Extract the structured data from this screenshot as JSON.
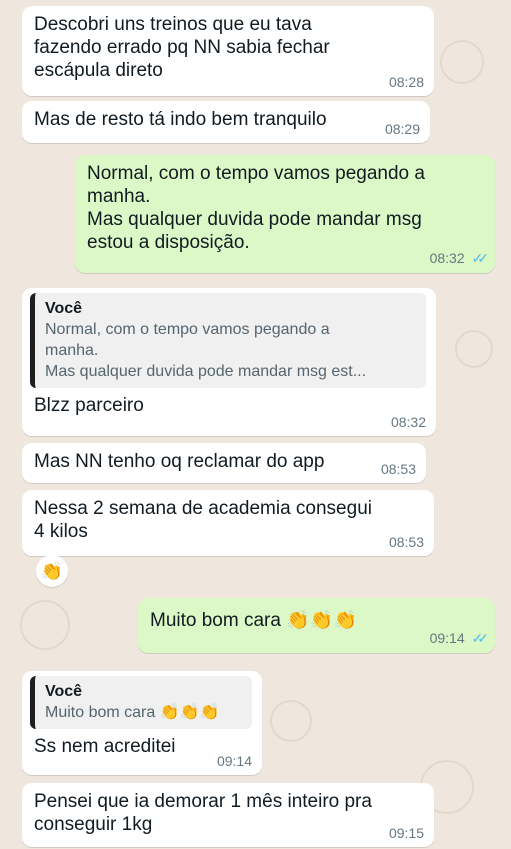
{
  "messages": [
    {
      "text": "Descobri uns treinos que eu tava\nfazendo errado pq NN sabia fechar\nescápula direto",
      "time": "08:28"
    },
    {
      "text": "Mas de resto tá indo bem tranquilo",
      "time": "08:29"
    },
    {
      "text": "Normal, com o tempo vamos pegando a\nmanha.\nMas qualquer duvida pode mandar msg\nestou a disposição.",
      "time": "08:32",
      "status": "read"
    },
    {
      "quote_author": "Você",
      "quote_text": "Normal, com o tempo vamos pegando a\nmanha.\nMas qualquer duvida pode mandar msg est...",
      "text": "Blzz parceiro",
      "time": "08:32"
    },
    {
      "text": "Mas NN tenho oq reclamar do app",
      "time": "08:53"
    },
    {
      "text": "Nessa 2 semana de academia consegui\n4 kilos",
      "time": "08:53",
      "reaction": "👏"
    },
    {
      "text": "Muito bom cara 👏👏👏",
      "time": "09:14",
      "status": "read"
    },
    {
      "quote_author": "Você",
      "quote_text": "Muito bom cara 👏👏👏",
      "text": "Ss nem acreditei",
      "time": "09:14"
    },
    {
      "text": "Pensei que ia demorar 1 mês inteiro pra\nconseguir 1kg",
      "time": "09:15"
    }
  ],
  "read_ticks": "✓✓",
  "colors": {
    "incoming": "#ffffff",
    "outgoing": "#dcf8c6",
    "read_tick": "#53bdeb",
    "wallpaper": "#efe7de"
  }
}
